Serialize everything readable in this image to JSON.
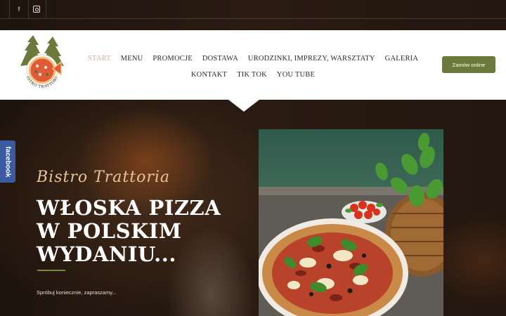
{
  "social": {
    "facebook_glyph": "f",
    "icons": [
      "facebook-icon",
      "instagram-icon"
    ]
  },
  "nav": {
    "row1": [
      {
        "label": "START",
        "active": true
      },
      {
        "label": "MENU"
      },
      {
        "label": "PROMOCJE"
      },
      {
        "label": "DOSTAWA"
      },
      {
        "label": "URODZINKI, IMPREZY, WARSZTATY"
      },
      {
        "label": "GALERIA"
      }
    ],
    "row2": [
      {
        "label": "KONTAKT"
      },
      {
        "label": "TIK TOK"
      },
      {
        "label": "YOU TUBE"
      }
    ],
    "active_color": "#e8a7a0"
  },
  "order_button": "Zamów online",
  "facebook_tab": "facebook",
  "logo": {
    "text": "BISTRO TRATTORIA",
    "accent": "#6b7a3a"
  },
  "hero": {
    "script_title": "Bistro Trattoria",
    "headline_lines": [
      "WŁOSKA PIZZA",
      "W POLSKIM",
      "WYDANIU..."
    ],
    "subtext": "Spróbuj koniecznie, zapraszamy..."
  },
  "colors": {
    "brand_green": "#6b7a3a",
    "facebook_blue": "#3b5aa0",
    "script_gold": "#e7c29a"
  }
}
